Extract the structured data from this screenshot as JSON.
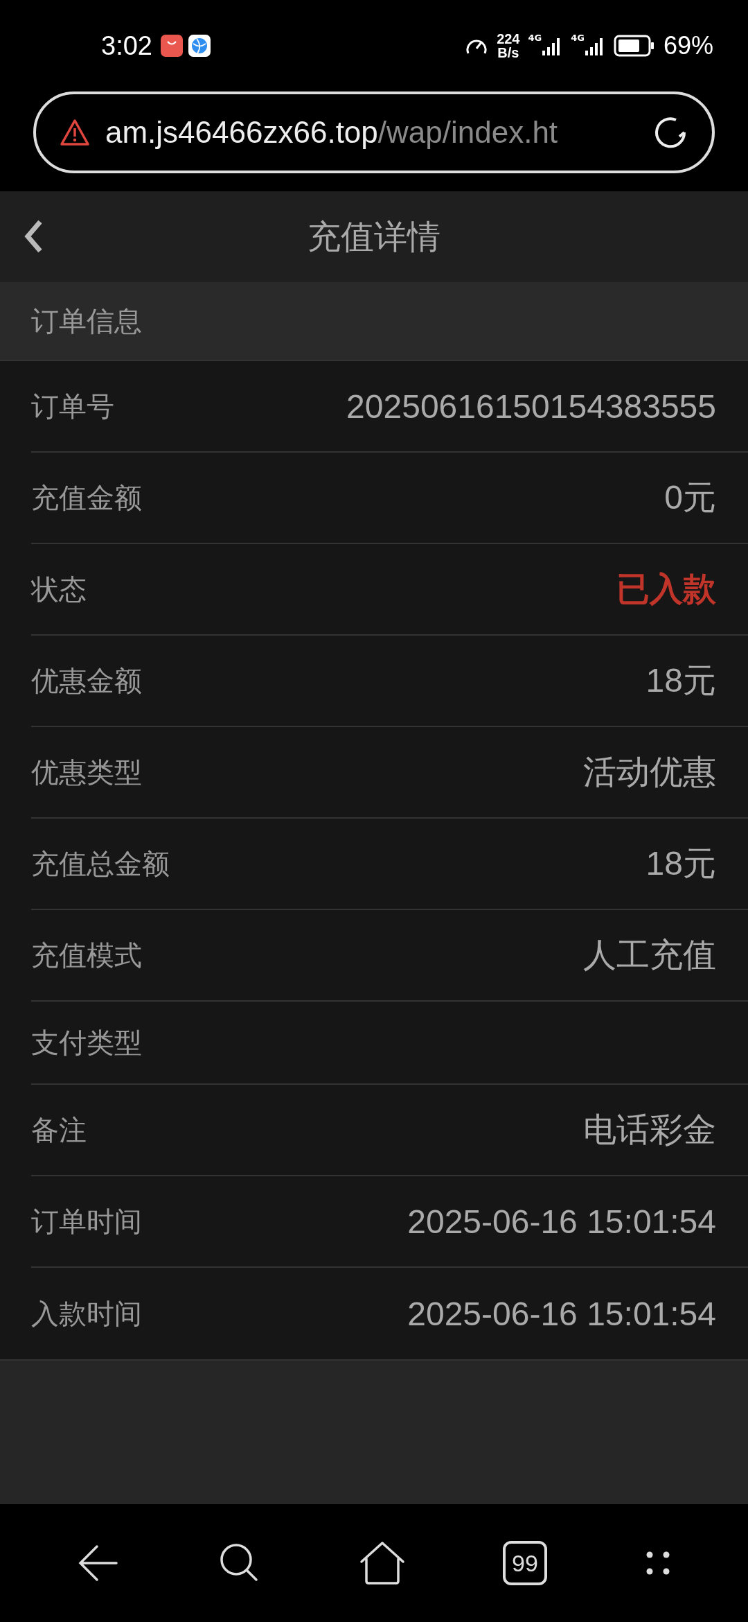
{
  "status_bar": {
    "time": "3:02",
    "speed_value": "224",
    "speed_unit": "B/s",
    "network_labels": [
      "4G",
      "4G"
    ],
    "battery_percent": "69%"
  },
  "address_bar": {
    "host": "am.js46466zx66.top",
    "path": "/wap/index.ht"
  },
  "header": {
    "title": "充值详情"
  },
  "section": {
    "title": "订单信息"
  },
  "rows": [
    {
      "label": "订单号",
      "value": "20250616150154383555",
      "kind": "text"
    },
    {
      "label": "充值金额",
      "value": "0元",
      "kind": "text"
    },
    {
      "label": "状态",
      "value": "已入款",
      "kind": "status"
    },
    {
      "label": "优惠金额",
      "value": "18元",
      "kind": "text"
    },
    {
      "label": "优惠类型",
      "value": "活动优惠",
      "kind": "text"
    },
    {
      "label": "充值总金额",
      "value": "18元",
      "kind": "text"
    },
    {
      "label": "充值模式",
      "value": "人工充值",
      "kind": "text"
    },
    {
      "label": "支付类型",
      "kind": "empty"
    },
    {
      "label": "备注",
      "value": "电话彩金",
      "kind": "text"
    },
    {
      "label": "订单时间",
      "value": "2025-06-16 15:01:54",
      "kind": "text"
    },
    {
      "label": "入款时间",
      "value": "2025-06-16 15:01:54",
      "kind": "text"
    }
  ],
  "tab_count": "99"
}
